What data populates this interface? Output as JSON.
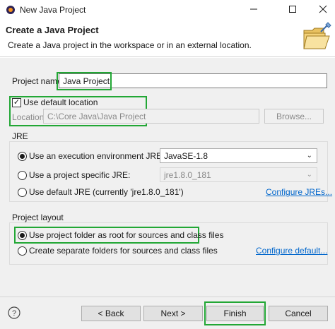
{
  "window": {
    "title": "New Java Project",
    "minimize_icon": "minimize-icon",
    "maximize_icon": "maximize-icon",
    "close_icon": "close-icon"
  },
  "banner": {
    "title": "Create a Java Project",
    "description": "Create a Java project in the workspace or in an external location.",
    "icon": "folder-icon"
  },
  "project": {
    "name_label": "Project name:",
    "name_value": "Java Project"
  },
  "location": {
    "use_default_label": "Use default location",
    "use_default_checked": true,
    "location_label": "Location:",
    "location_value": "C:\\Core Java\\Java Project",
    "browse_label": "Browse..."
  },
  "jre": {
    "group_title": "JRE",
    "options": [
      {
        "label": "Use an execution environment JRE:",
        "selected": true
      },
      {
        "label": "Use a project specific JRE:",
        "selected": false
      },
      {
        "label": "Use default JRE (currently 'jre1.8.0_181')",
        "selected": false
      }
    ],
    "env_combo": "JavaSE-1.8",
    "specific_combo": "jre1.8.0_181",
    "configure_link": "Configure JREs..."
  },
  "layout": {
    "group_title": "Project layout",
    "options": [
      {
        "label": "Use project folder as root for sources and class files",
        "selected": true
      },
      {
        "label": "Create separate folders for sources and class files",
        "selected": false
      }
    ],
    "configure_link": "Configure default..."
  },
  "footer": {
    "help_icon": "help-icon",
    "back_label": "< Back",
    "next_label": "Next >",
    "finish_label": "Finish",
    "cancel_label": "Cancel"
  },
  "colors": {
    "highlight": "#22a735",
    "link": "#0066cc"
  }
}
